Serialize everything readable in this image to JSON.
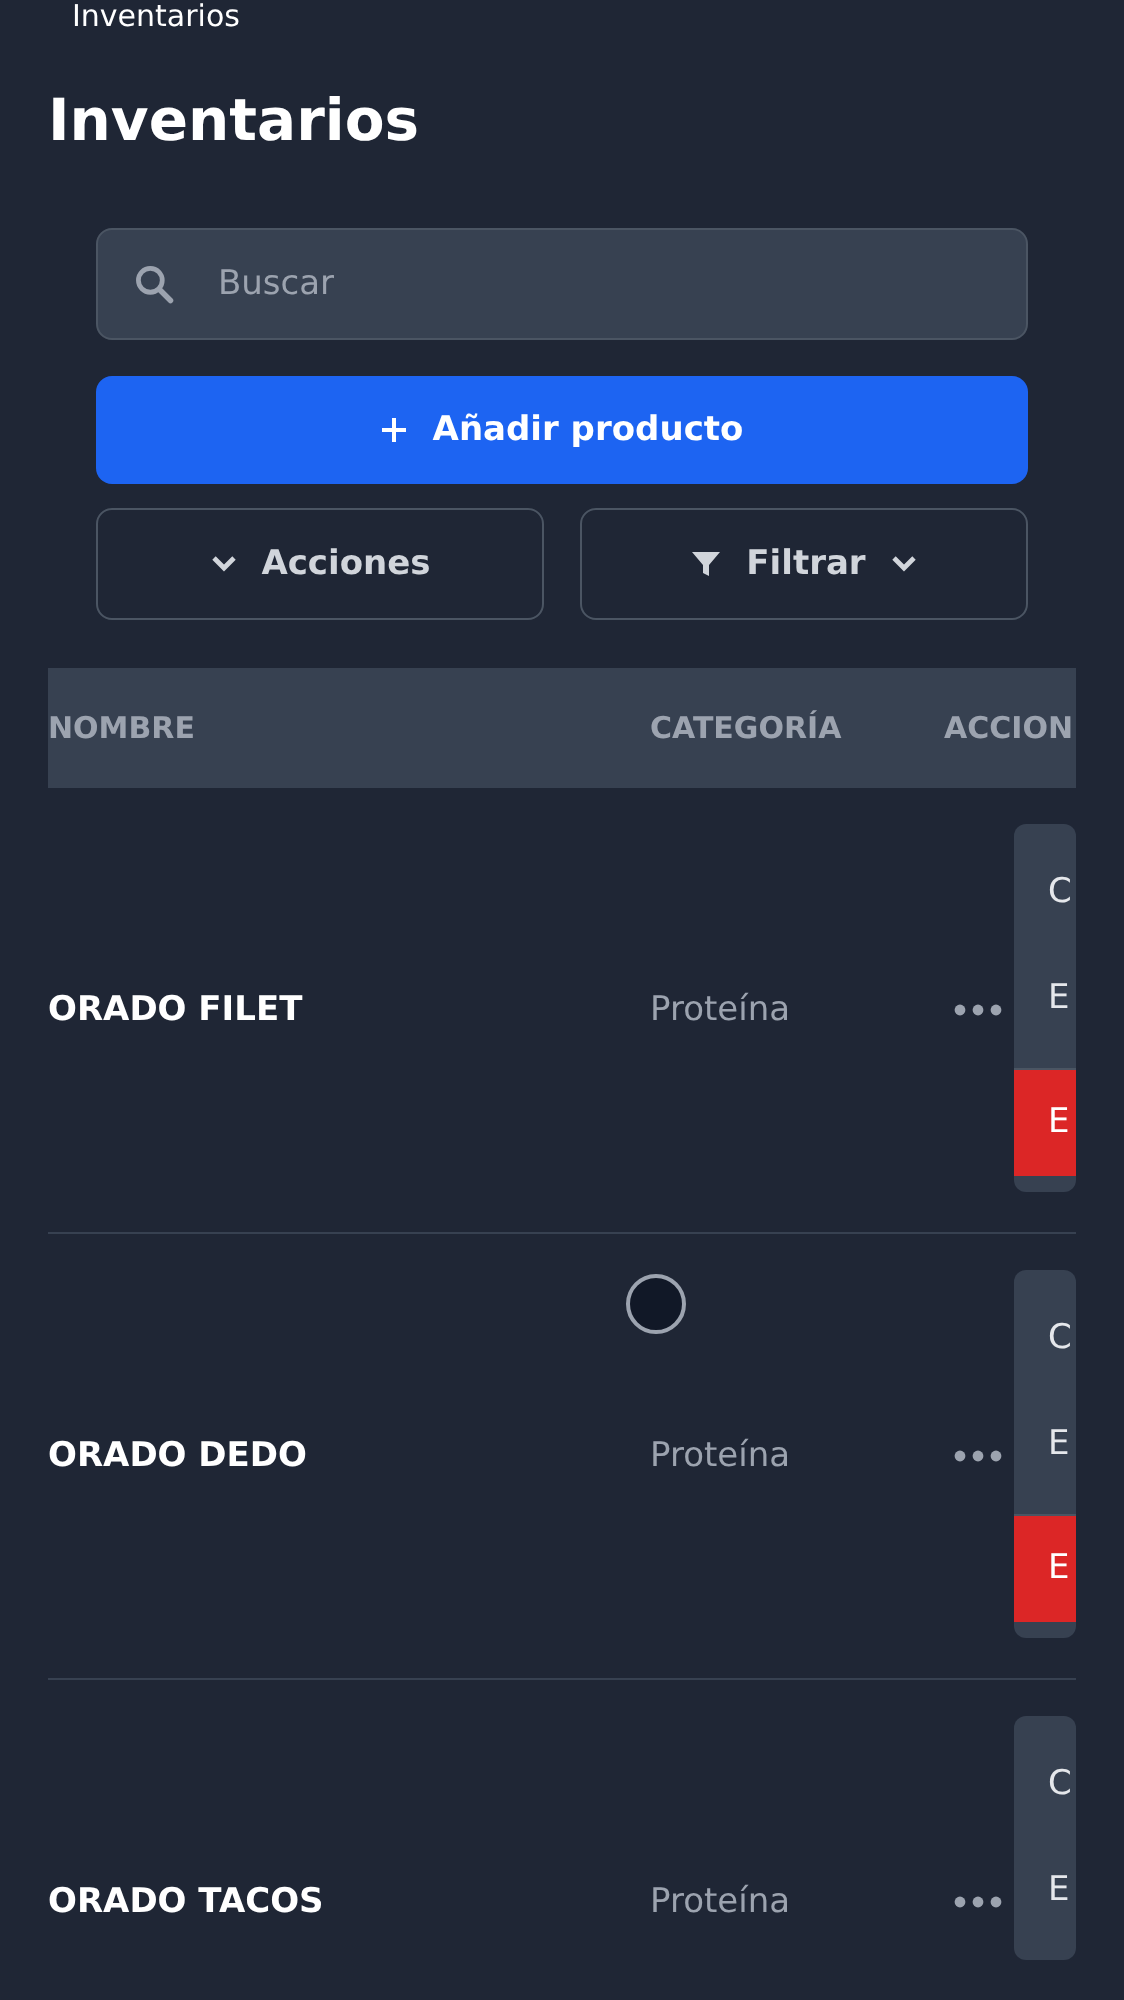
{
  "top_bar": {
    "title": "Inventarios"
  },
  "page": {
    "title": "Inventarios"
  },
  "search": {
    "placeholder": "Buscar"
  },
  "add_button": {
    "label": "Añadir producto"
  },
  "toolbar": [
    {
      "kind": "actions",
      "label": "Acciones"
    },
    {
      "kind": "filter",
      "label": "Filtrar"
    }
  ],
  "table": {
    "columns": [
      "NOMBRE",
      "CATEGORÍA",
      "ACCION"
    ],
    "rows": [
      {
        "name": "ORADO FILET",
        "category": "Proteína",
        "menu": [
          {
            "kind": "normal",
            "label": "C"
          },
          {
            "kind": "normal",
            "label": "E"
          },
          {
            "kind": "danger",
            "label": "E"
          }
        ]
      },
      {
        "name": "ORADO DEDO",
        "category": "Proteína",
        "menu": [
          {
            "kind": "normal",
            "label": "C"
          },
          {
            "kind": "normal",
            "label": "E"
          },
          {
            "kind": "danger",
            "label": "E"
          }
        ]
      },
      {
        "name": "ORADO TACOS",
        "category": "Proteína",
        "menu": [
          {
            "kind": "normal",
            "label": "C"
          },
          {
            "kind": "normal",
            "label": "E"
          }
        ]
      }
    ]
  }
}
